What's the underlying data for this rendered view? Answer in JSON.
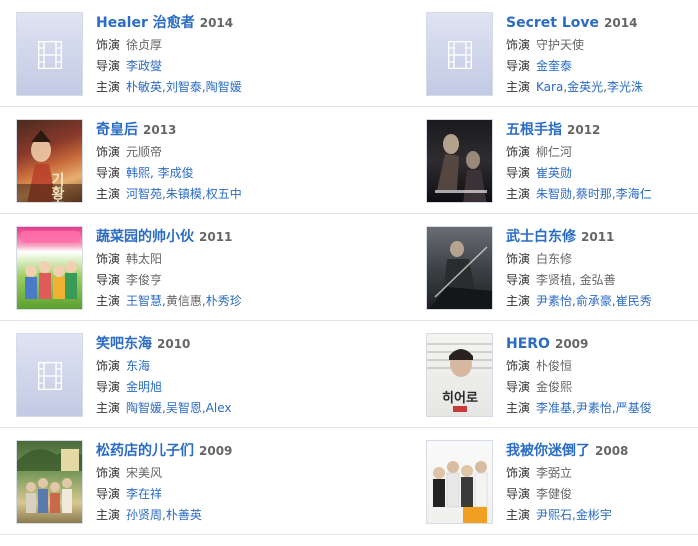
{
  "labels": {
    "role": "饰演",
    "director": "导演",
    "cast": "主演",
    "comma": ","
  },
  "colors": {
    "title_link": "#2b6cc4",
    "year": "#666666",
    "separator": "#e3e3e3",
    "placeholder_top": "#dfe4f2",
    "placeholder_bottom": "#c2cae4"
  },
  "rows": [
    {
      "left": {
        "title": "Healer 治愈者",
        "year": "2014",
        "poster": "placeholder",
        "role": "徐贞厚",
        "director": "李政燮",
        "cast": [
          "朴敏英",
          "刘智泰",
          "陶智媛"
        ]
      },
      "right": {
        "title": "Secret Love",
        "year": "2014",
        "poster": "placeholder",
        "role": "守护天使",
        "director": "金奎泰",
        "cast": [
          "Kara",
          "金英光",
          "李光洙"
        ]
      }
    },
    {
      "left": {
        "title": "奇皇后",
        "year": "2013",
        "poster": "empress-ki",
        "poster_text": "기황후",
        "role": "元顺帝",
        "director": "韩熙, 李成俊",
        "cast": [
          "河智苑",
          "朱镇模",
          "权五中"
        ]
      },
      "right": {
        "title": "五根手指",
        "year": "2012",
        "poster": "five-fingers",
        "role": "柳仁河",
        "director": "崔英勋",
        "cast": [
          "朱智勋",
          "蔡时那",
          "李海仁"
        ]
      }
    },
    {
      "left": {
        "title": "蔬菜园的帅小伙",
        "year": "2011",
        "poster": "vegetable-store",
        "role": "韩太阳",
        "director": "李俊亨",
        "cast": [
          "王智慧",
          "黄信惠",
          "朴秀珍"
        ]
      },
      "right": {
        "title": "武士白东修",
        "year": "2011",
        "poster": "warrior",
        "role": "白东修",
        "director": "李贤植, 金弘善",
        "cast": [
          "尹素怡",
          "俞承豪",
          "崔民秀"
        ]
      }
    },
    {
      "left": {
        "title": "笑吧东海",
        "year": "2010",
        "poster": "placeholder",
        "role": "东海",
        "director": "金明旭",
        "cast": [
          "陶智媛",
          "吴智恩",
          "Alex"
        ]
      },
      "right": {
        "title": "HERO",
        "year": "2009",
        "poster": "hero",
        "poster_text": "히어로",
        "role": "朴俊恒",
        "director": "金俊熙",
        "cast": [
          "李准基",
          "尹素怡",
          "严基俊"
        ]
      }
    },
    {
      "left": {
        "title": "松药店的儿子们",
        "year": "2009",
        "poster": "pharmacy",
        "role": "宋美风",
        "director": "李在祥",
        "cast": [
          "孙贤周",
          "朴善英"
        ]
      },
      "right": {
        "title": "我被你迷倒了",
        "year": "2008",
        "poster": "fascinated",
        "role": "李弼立",
        "director": "李健俊",
        "cast": [
          "尹熙石",
          "金彬宇"
        ]
      }
    }
  ]
}
